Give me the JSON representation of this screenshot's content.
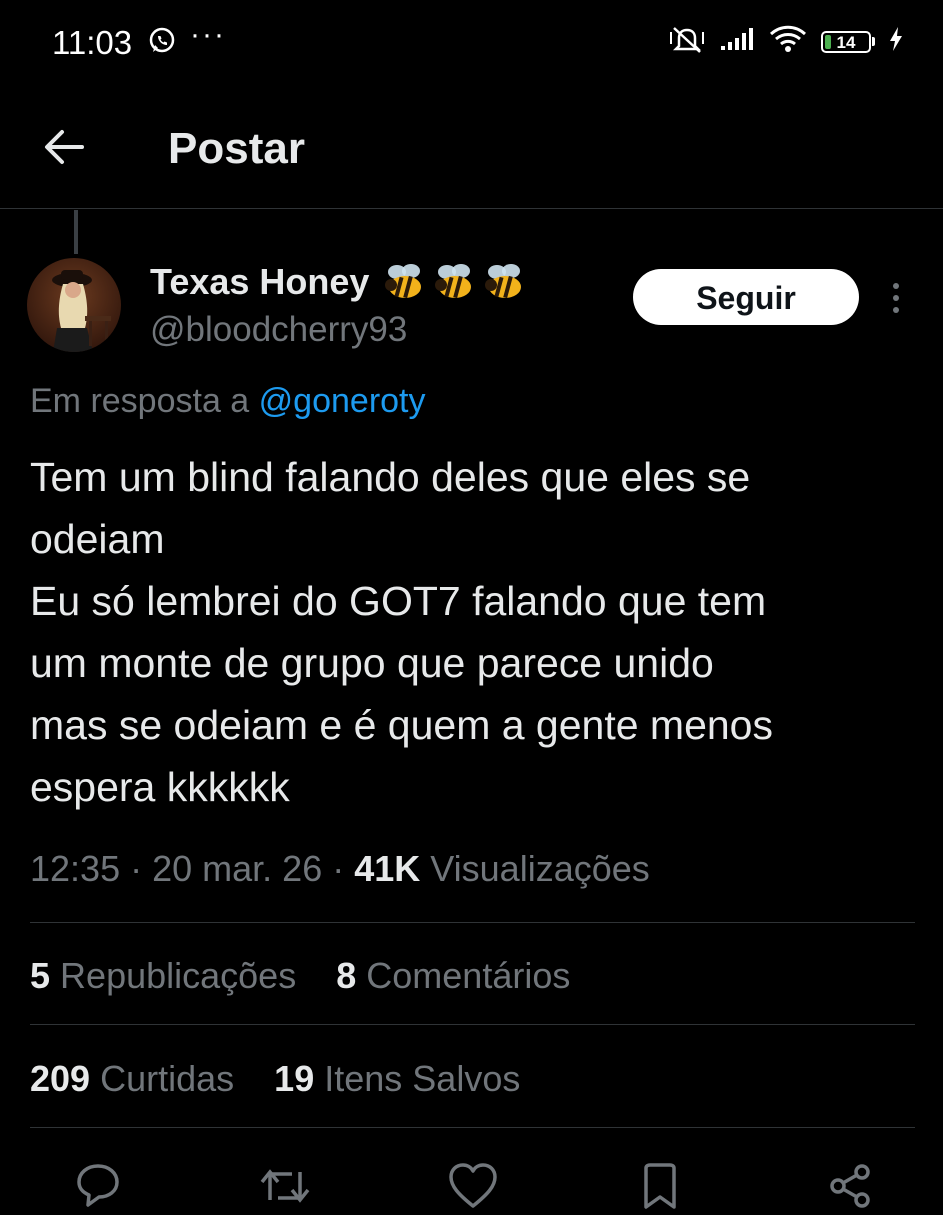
{
  "status_bar": {
    "time": "11:03",
    "more_dots": "···",
    "battery_level": "14",
    "icons": [
      "whatsapp-icon",
      "mute-icon",
      "signal-icon",
      "wifi-icon",
      "battery-icon",
      "charging-icon"
    ]
  },
  "header": {
    "title": "Postar",
    "back_icon": "arrow-left-icon"
  },
  "author": {
    "name": "Texas Honey",
    "handle": "@bloodcherry93",
    "emoji": [
      "bee",
      "bee",
      "bee"
    ],
    "follow_label": "Seguir"
  },
  "reply": {
    "prefix": "Em resposta a",
    "mention": "@goneroty"
  },
  "tweet": {
    "lines": [
      "Tem um blind falando deles que eles se",
      "odeiam",
      "Eu só lembrei do GOT7 falando que tem",
      "um monte de grupo que parece unido",
      "mas se odeiam e é quem a gente menos",
      "espera kkkkkk"
    ]
  },
  "meta": {
    "time": "12:35",
    "date": "20 mar. 26",
    "views_count": "41K",
    "views_label": "Visualizações"
  },
  "stats": {
    "reposts_count": "5",
    "reposts_label": "Republicações",
    "comments_count": "8",
    "comments_label": "Comentários",
    "likes_count": "209",
    "likes_label": "Curtidas",
    "saves_count": "19",
    "saves_label": "Itens Salvos"
  },
  "actions": [
    "reply-icon",
    "repost-icon",
    "like-icon",
    "bookmark-icon",
    "share-icon"
  ],
  "colors": {
    "background": "#000000",
    "text": "#e7e9ea",
    "muted": "#71767b",
    "link": "#1d9bf0",
    "divider": "#2f3336",
    "battery": "#4caf50"
  }
}
